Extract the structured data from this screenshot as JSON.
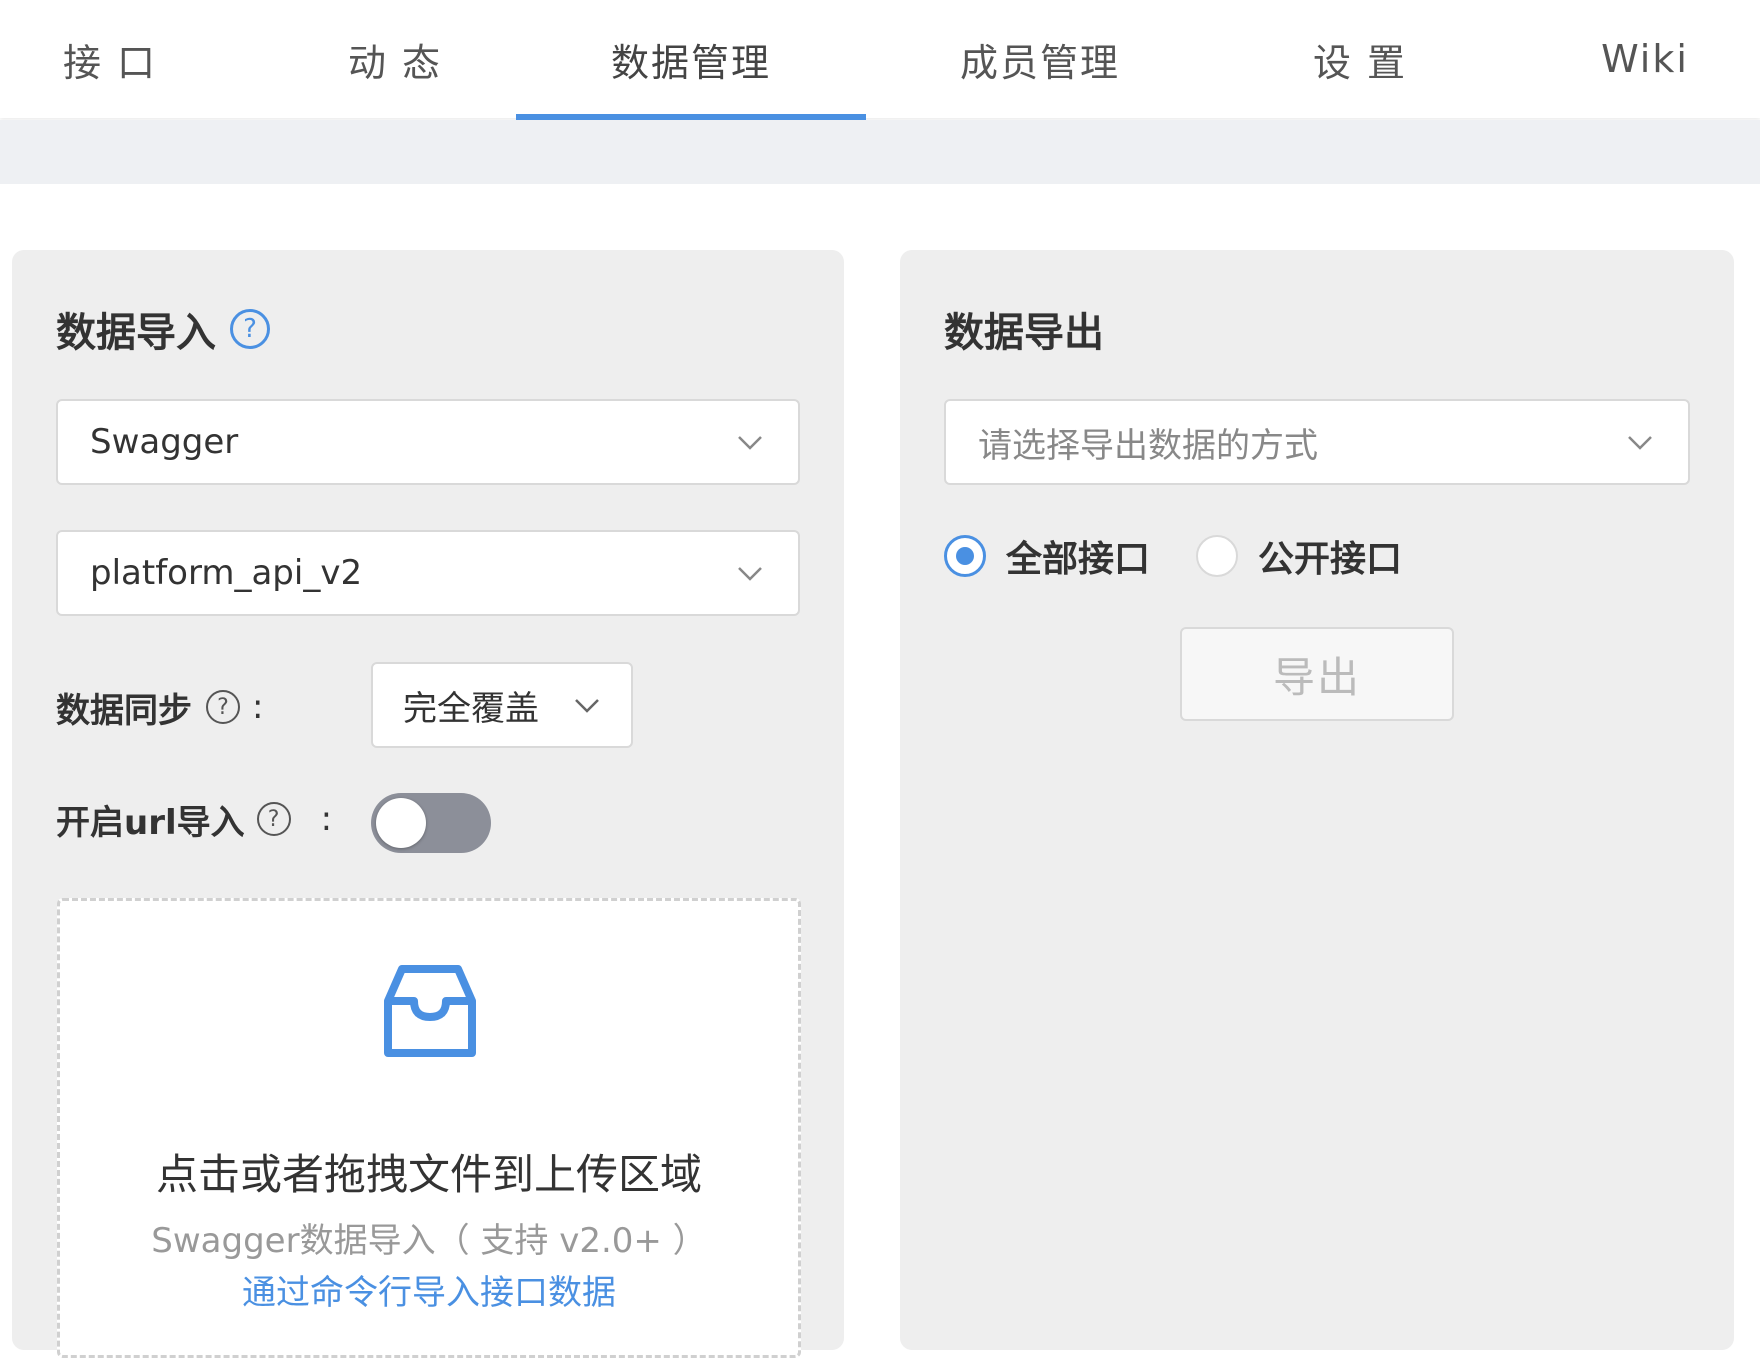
{
  "nav": {
    "tabs": [
      {
        "label": "接 口"
      },
      {
        "label": "动 态"
      },
      {
        "label": "数据管理"
      },
      {
        "label": "成员管理"
      },
      {
        "label": "设 置"
      },
      {
        "label": "Wiki"
      }
    ],
    "active_index": 2,
    "accent_color": "#4a90e2"
  },
  "import_panel": {
    "title": "数据导入",
    "help_glyph": "?",
    "type_select": {
      "value": "Swagger"
    },
    "project_select": {
      "value": "platform_api_v2"
    },
    "sync": {
      "label": "数据同步",
      "colon": ":",
      "help_glyph": "?",
      "value": "完全覆盖"
    },
    "url_import": {
      "label": "开启url导入",
      "colon": ":",
      "help_glyph": "?",
      "enabled": false
    },
    "dropzone": {
      "icon": "inbox-icon",
      "main_text": "点击或者拖拽文件到上传区域",
      "hint": "Swagger数据导入（ 支持 v2.0+ ）",
      "link": "通过命令行导入接口数据"
    }
  },
  "export_panel": {
    "title": "数据导出",
    "method_select": {
      "placeholder": "请选择导出数据的方式"
    },
    "scope_options": [
      {
        "label": "全部接口",
        "checked": true
      },
      {
        "label": "公开接口",
        "checked": false
      }
    ],
    "export_button": "导出"
  }
}
